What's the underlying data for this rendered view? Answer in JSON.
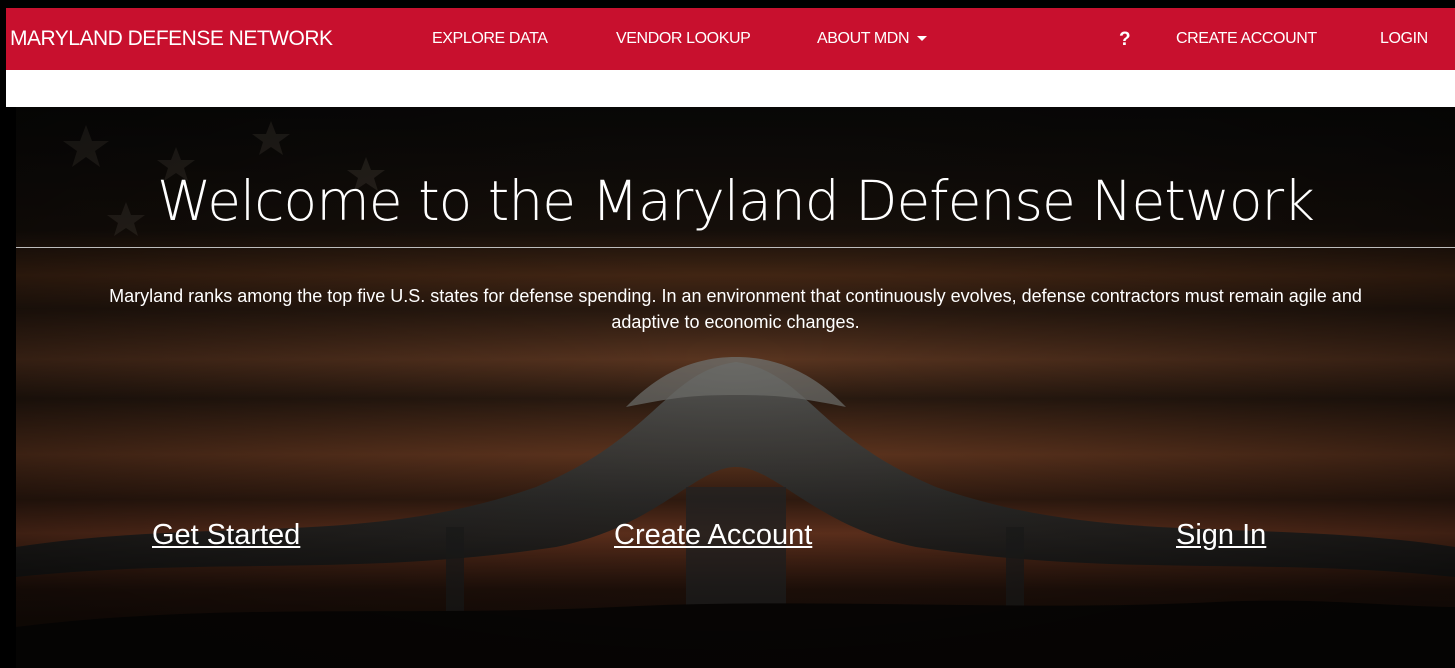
{
  "nav": {
    "brand": "MARYLAND DEFENSE NETWORK",
    "explore_data": "EXPLORE DATA",
    "vendor_lookup": "VENDOR LOOKUP",
    "about": "ABOUT MDN",
    "help": "?",
    "create_account": "CREATE ACCOUNT",
    "login": "LOGIN"
  },
  "hero": {
    "title": "Welcome to the Maryland Defense Network",
    "description": "Maryland ranks among the top five U.S. states for defense spending. In an environment that continuously evolves, defense contractors must remain agile and adaptive to economic changes.",
    "get_started": "Get Started",
    "create_account": "Create Account",
    "sign_in": "Sign In"
  },
  "colors": {
    "nav_background": "#c8102e",
    "page_background": "#000000",
    "text": "#ffffff"
  }
}
